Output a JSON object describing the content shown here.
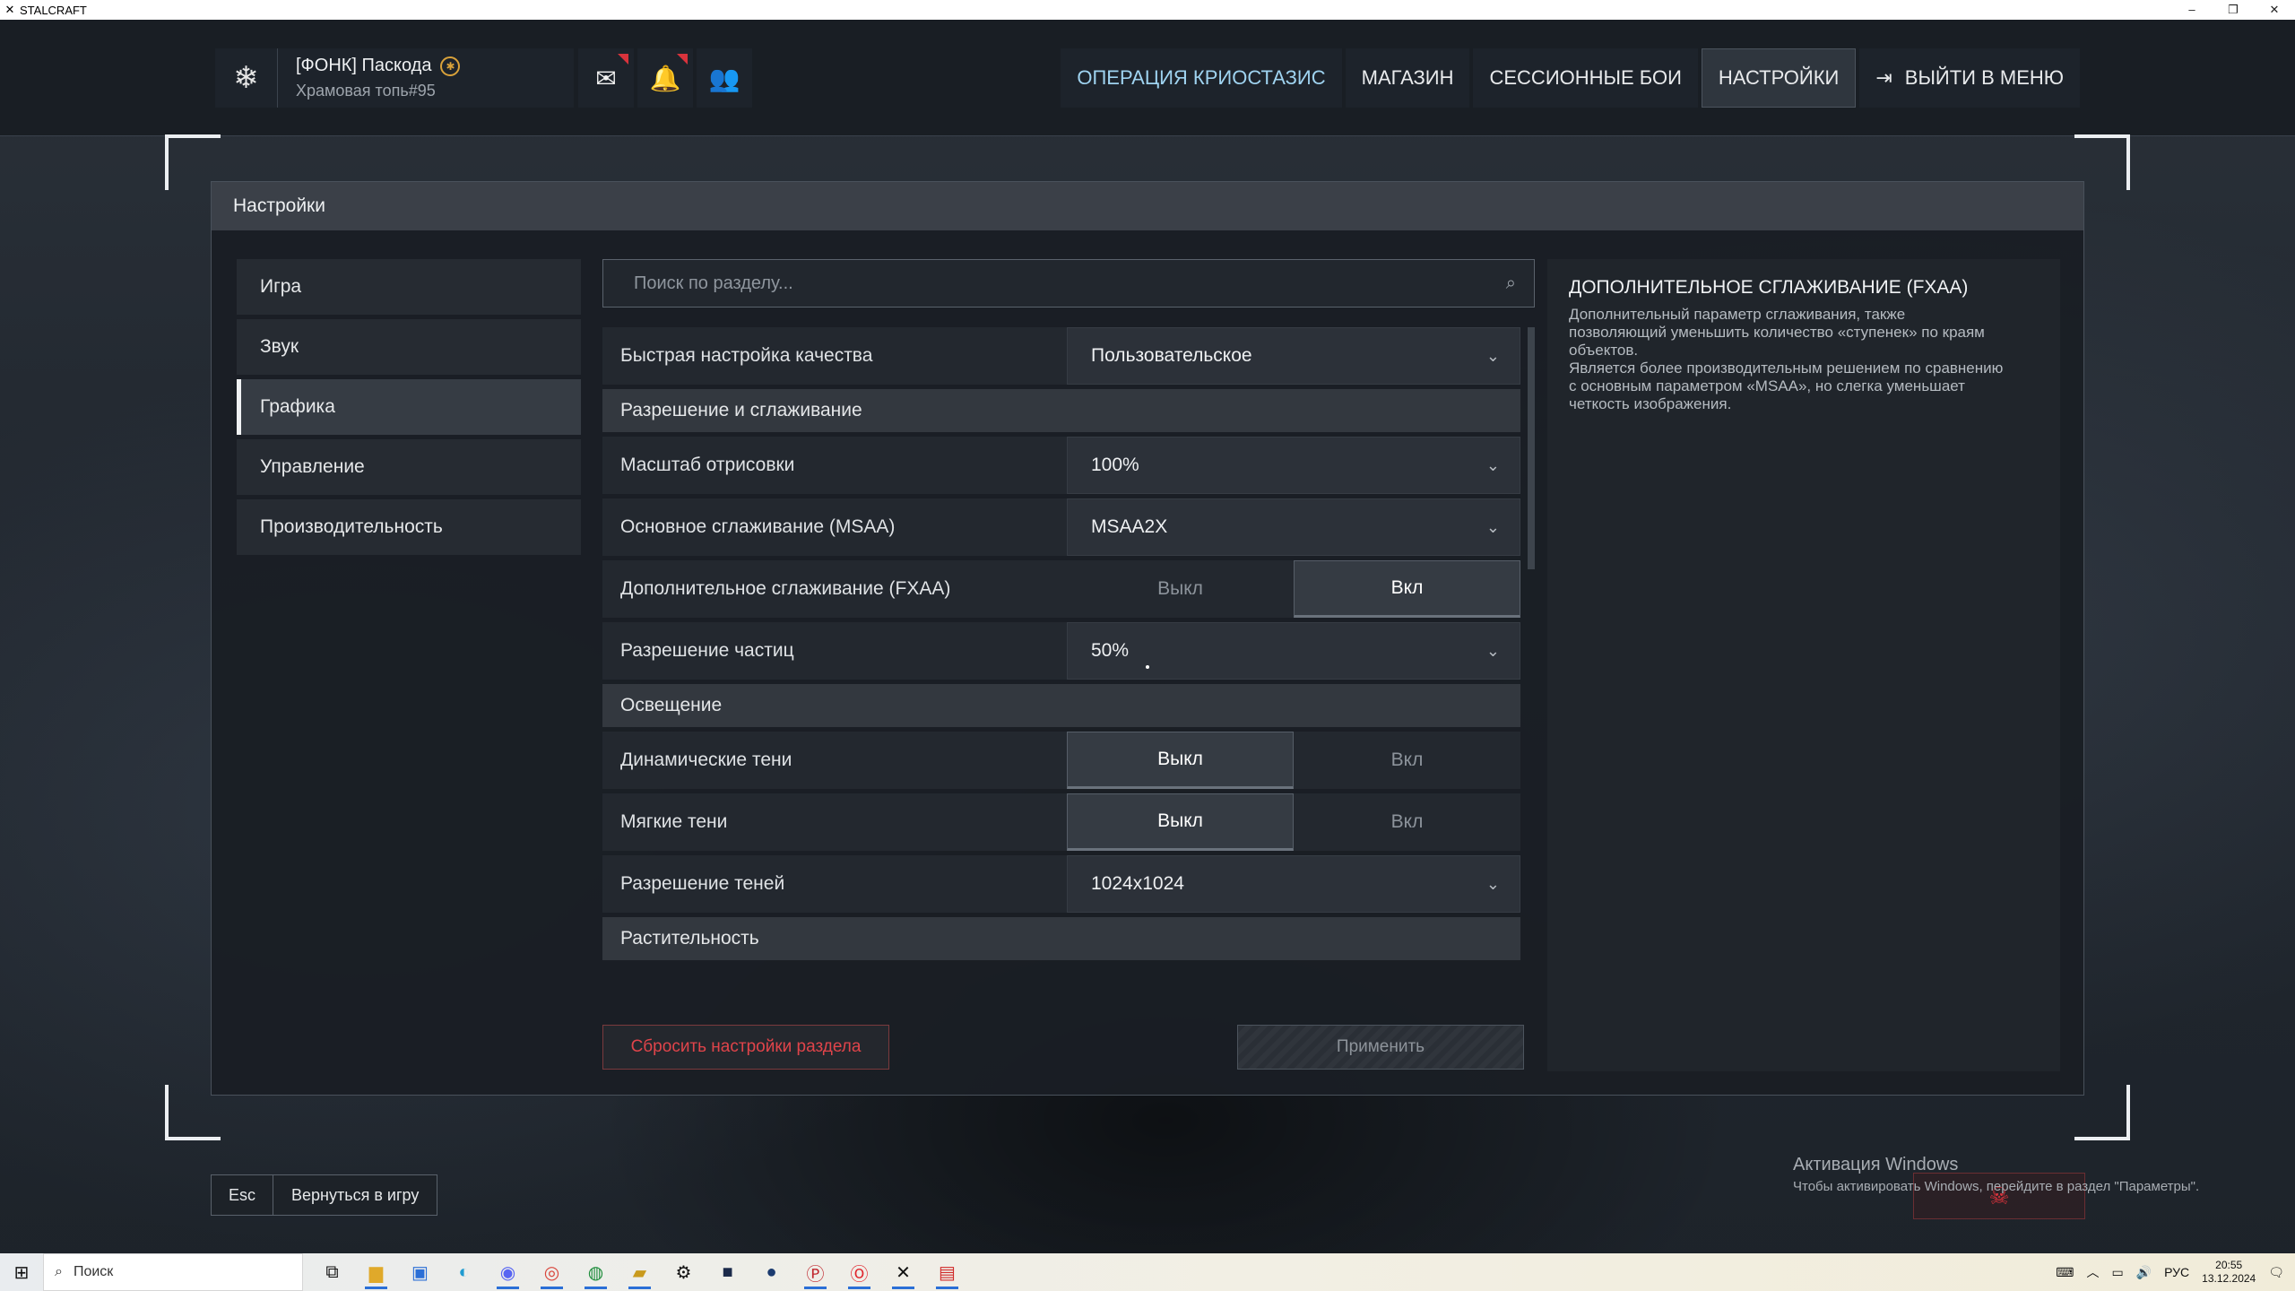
{
  "window": {
    "title": "STALCRAFT",
    "app_icon": "stalcraft-logo-icon",
    "controls": [
      "minimize-icon",
      "restore-icon",
      "close-icon"
    ]
  },
  "profile": {
    "name": "[ФОНК] Паскода",
    "subtitle": "Храмовая топь#95",
    "logo_icon": "snowflake-icon",
    "clan_badge_icon": "clan-badge-icon"
  },
  "top_icons": [
    {
      "name": "mail-icon",
      "glyph": "✉",
      "notification": true
    },
    {
      "name": "bell-icon",
      "glyph": "🔔",
      "notification": true
    },
    {
      "name": "friends-icon",
      "glyph": "👥",
      "notification": false
    }
  ],
  "nav": {
    "event": "ОПЕРАЦИЯ КРИОСТАЗИС",
    "shop": "МАГАЗИН",
    "sessions": "СЕССИОННЫЕ БОИ",
    "settings": "НАСТРОЙКИ",
    "exit": "ВЫЙТИ В МЕНЮ"
  },
  "panel": {
    "title": "Настройки",
    "categories": [
      "Игра",
      "Звук",
      "Графика",
      "Управление",
      "Производительность"
    ],
    "active_category": "Графика",
    "search_placeholder": "Поиск по разделу...",
    "quick_quality": {
      "label": "Быстрая настройка качества",
      "value": "Пользовательское"
    },
    "section_resolution": "Разрешение и сглаживание",
    "render_scale": {
      "label": "Масштаб отрисовки",
      "value": "100%"
    },
    "msaa": {
      "label": "Основное сглаживание (MSAA)",
      "value": "MSAA2X"
    },
    "fxaa": {
      "label": "Дополнительное сглаживание (FXAA)",
      "off": "Выкл",
      "on": "Вкл",
      "selected": "on"
    },
    "particle_res": {
      "label": "Разрешение частиц",
      "value": "50%"
    },
    "section_lighting": "Освещение",
    "dynamic_shadows": {
      "label": "Динамические тени",
      "off": "Выкл",
      "on": "Вкл",
      "selected": "off"
    },
    "soft_shadows": {
      "label": "Мягкие тени",
      "off": "Выкл",
      "on": "Вкл",
      "selected": "off"
    },
    "shadow_res": {
      "label": "Разрешение теней",
      "value": "1024x1024"
    },
    "section_vegetation": "Растительность",
    "reset_button": "Сбросить настройки раздела",
    "apply_button": "Применить",
    "description": {
      "title": "ДОПОЛНИТЕЛЬНОЕ СГЛАЖИВАНИЕ (FXAA)",
      "body": "Дополнительный параметр сглаживания, также\nпозволяющий уменьшить количество «ступенек» по краям\nобъектов.\nЯвляется более производительным решением по сравнению\nс основным параметром «MSAA», но слегка уменьшает\nчеткость изображения."
    }
  },
  "bottom": {
    "esc_key": "Esc",
    "esc_label": "Вернуться в игру",
    "activation_title": "Активация Windows",
    "activation_text": "Чтобы активировать Windows, перейдите в раздел \"Параметры\".",
    "skull_icon": "skull-icon"
  },
  "taskbar": {
    "search_placeholder": "Поиск",
    "apps": [
      "task-view-icon",
      "file-explorer-icon",
      "store-icon",
      "edge-icon",
      "discord-icon",
      "chrome-icon",
      "xbox-icon",
      "game-icon",
      "settings-icon",
      "terminal-icon",
      "steam-icon",
      "p-app-icon",
      "opera-icon",
      "stalcraft-icon",
      "app-64-icon"
    ],
    "tray_lang": "РУС",
    "time": "20:55",
    "date": "13.12.2024"
  }
}
